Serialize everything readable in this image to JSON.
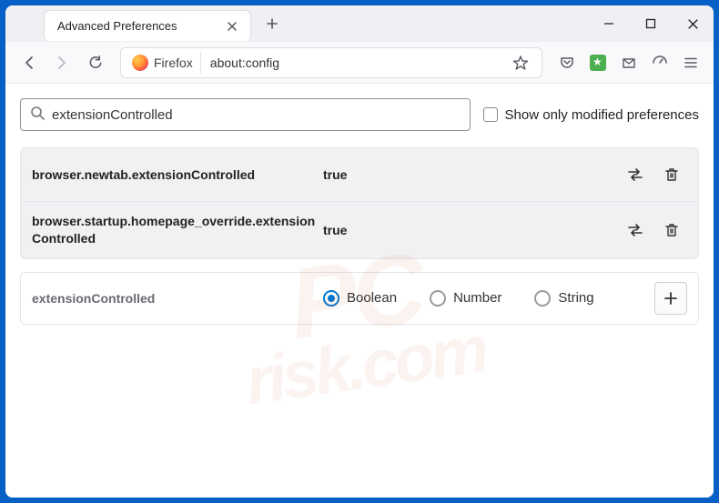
{
  "window": {
    "tab_title": "Advanced Preferences"
  },
  "url": {
    "brand": "Firefox",
    "value": "about:config"
  },
  "search": {
    "value": "extensionControlled",
    "checkbox_label": "Show only modified preferences"
  },
  "prefs": [
    {
      "name": "browser.newtab.extensionControlled",
      "value": "true"
    },
    {
      "name": "browser.startup.homepage_override.extensionControlled",
      "value": "true"
    }
  ],
  "newpref": {
    "name": "extensionControlled",
    "types": {
      "boolean": "Boolean",
      "number": "Number",
      "string": "String"
    }
  },
  "watermark": {
    "line1": "PC",
    "line2": "risk.com"
  }
}
